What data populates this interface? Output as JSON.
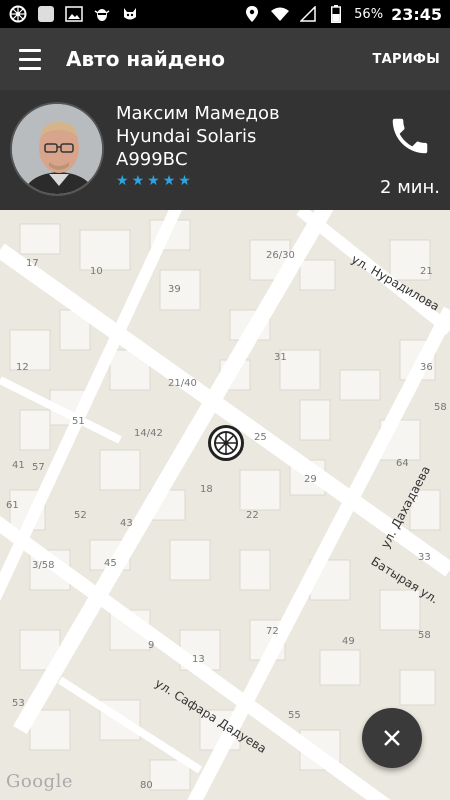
{
  "status_bar": {
    "battery": "56%",
    "time": "23:45",
    "icons": [
      "wheel-icon",
      "blank-app-icon",
      "image-icon",
      "bug-icon",
      "cat-icon",
      "location-icon",
      "wifi-icon",
      "no-sim-icon",
      "battery-icon"
    ]
  },
  "app_bar": {
    "title": "Авто найдено",
    "tariffs_label": "ТАРИФЫ",
    "menu_icon": "menu-icon"
  },
  "driver": {
    "name": "Максим Мамедов",
    "car": "Hyundai  Solaris",
    "plate": "А999ВС",
    "rating": 5,
    "rating_color": "#2aa5e2",
    "eta": "2 мин.",
    "call_icon": "phone-icon"
  },
  "map": {
    "labels": [
      "17",
      "10",
      "26/30",
      "21",
      "39",
      "12",
      "31",
      "36",
      "21/40",
      "58",
      "51",
      "14/42",
      "25",
      "41",
      "57",
      "64",
      "18",
      "29",
      "61",
      "52",
      "43",
      "22",
      "33",
      "3/58",
      "45",
      "72",
      "49",
      "9",
      "13",
      "58",
      "53",
      "55",
      "80"
    ],
    "streets": [
      "ул. Нурадилова",
      "ул. Дахадаева",
      "Батырая ул.",
      "ул. Сафара Дадуева"
    ],
    "attribution": "Google"
  },
  "fab": {
    "icon": "close-icon"
  },
  "colors": {
    "app_bar": "#3a3a3a",
    "card": "#333333",
    "accent": "#2aa5e2"
  }
}
